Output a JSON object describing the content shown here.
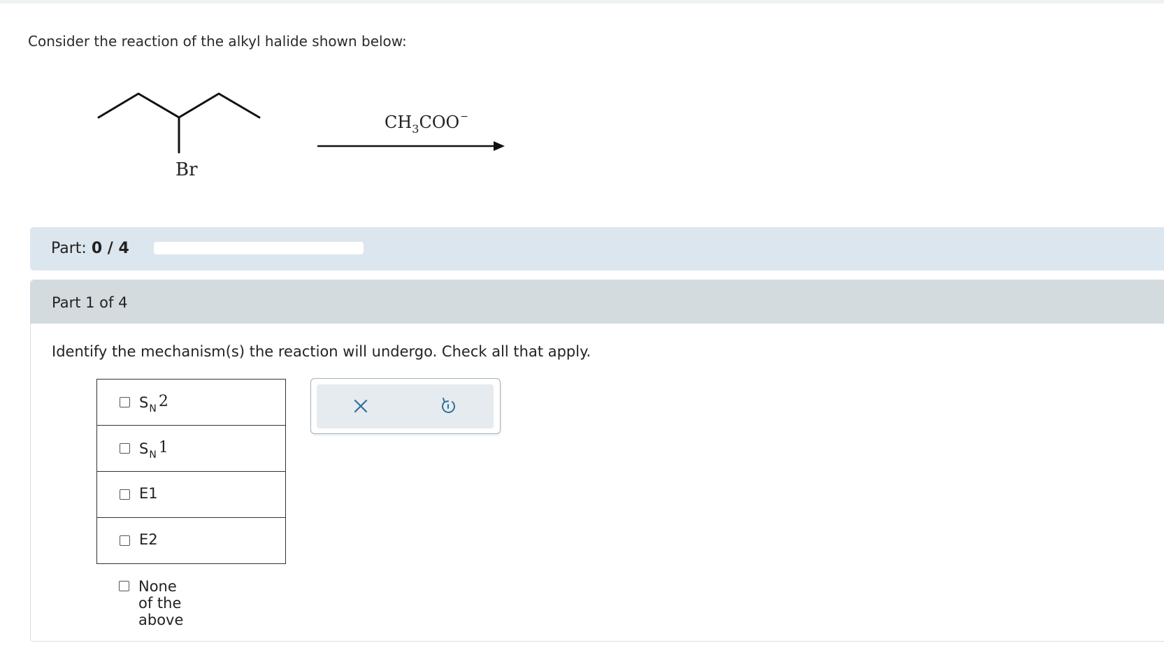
{
  "question": {
    "prompt": "Consider the reaction of the alkyl halide shown below:",
    "halogen_label": "Br",
    "reagent": {
      "base": "CH",
      "sub": "3",
      "rest": "COO",
      "charge": "−"
    }
  },
  "progress": {
    "label": "Part:",
    "value_text": "0 / 4",
    "fraction": 0
  },
  "part": {
    "title": "Part 1 of 4",
    "instruction": "Identify the mechanism(s) the reaction will undergo. Check all that apply.",
    "options": [
      {
        "letter": "S",
        "sub": "N",
        "num": "2"
      },
      {
        "letter": "S",
        "sub": "N",
        "num": "1"
      },
      {
        "label": "E1"
      },
      {
        "label": "E2"
      }
    ],
    "none_option": "None of the above"
  },
  "actions": {
    "clear_icon": "close-icon",
    "undo_icon": "undo-icon",
    "icon_color": "#2f6f9f"
  }
}
